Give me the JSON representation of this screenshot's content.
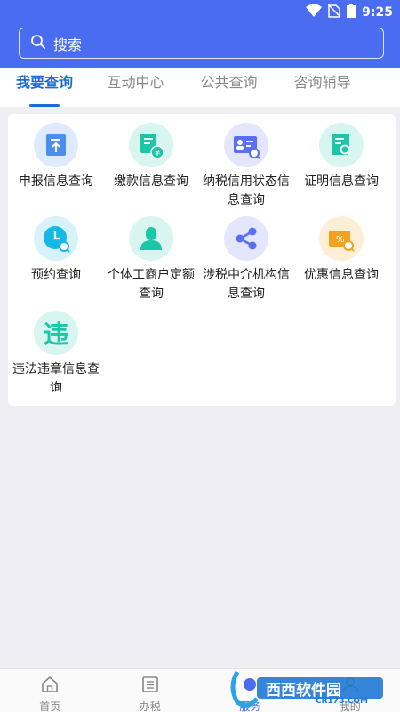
{
  "status_bar": {
    "time": "9:25"
  },
  "search": {
    "placeholder": "搜索"
  },
  "tabs": [
    {
      "label": "我要查询",
      "active": true
    },
    {
      "label": "互动中心",
      "active": false
    },
    {
      "label": "公共查询",
      "active": false
    },
    {
      "label": "咨询辅导",
      "active": false
    }
  ],
  "services": [
    {
      "label": "申报信息查询",
      "icon": "declare-upload-icon",
      "color": "#4a8ff0"
    },
    {
      "label": "缴款信息查询",
      "icon": "payment-yuan-icon",
      "color": "#1cc7a8"
    },
    {
      "label": "纳税信用状态信息查询",
      "icon": "id-card-search-icon",
      "color": "#5b6ff2"
    },
    {
      "label": "证明信息查询",
      "icon": "certificate-search-icon",
      "color": "#1cc7a8"
    },
    {
      "label": "预约查询",
      "icon": "clock-search-icon",
      "color": "#16b8e8"
    },
    {
      "label": "个体工商户定额查询",
      "icon": "person-icon",
      "color": "#1cc7a8"
    },
    {
      "label": "涉税中介机构信息查询",
      "icon": "share-nodes-icon",
      "color": "#5b6ff2"
    },
    {
      "label": "优惠信息查询",
      "icon": "discount-ticket-icon",
      "color": "#f2a21c"
    },
    {
      "label": "违法违章信息查询",
      "icon": "violation-char-icon",
      "color": "#1cc7a8",
      "glyph": "违"
    }
  ],
  "bottom_nav": [
    {
      "label": "首页",
      "icon": "home-icon",
      "active": false
    },
    {
      "label": "办税",
      "icon": "list-icon",
      "active": false
    },
    {
      "label": "服务",
      "icon": "service-icon",
      "active": true
    },
    {
      "label": "我的",
      "icon": "user-icon",
      "active": false
    }
  ],
  "watermark": {
    "text": "西西软件园",
    "subtext": "CR173.COM"
  }
}
